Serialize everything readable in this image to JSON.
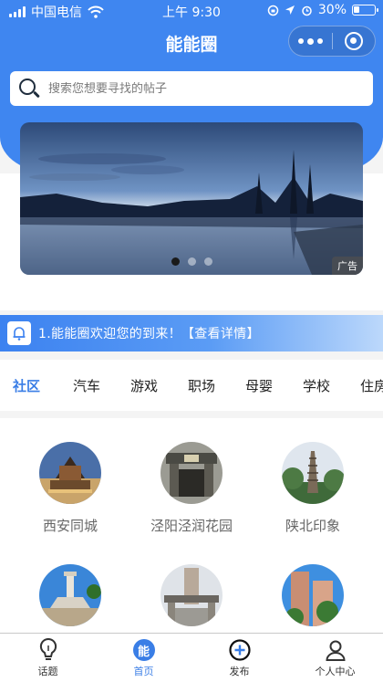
{
  "status_bar": {
    "carrier": "中国电信",
    "time": "上午 9:30",
    "battery": "30%"
  },
  "nav": {
    "title": "能能圈"
  },
  "search": {
    "placeholder": "搜索您想要寻找的帖子"
  },
  "banner": {
    "ad_label": "广告",
    "slide_count": 3,
    "active_slide": 1
  },
  "notice": {
    "text": "1.能能圈欢迎您的到来！【查看详情】"
  },
  "category_tabs": [
    {
      "label": "社区",
      "active": true
    },
    {
      "label": "汽车",
      "active": false
    },
    {
      "label": "游戏",
      "active": false
    },
    {
      "label": "职场",
      "active": false
    },
    {
      "label": "母婴",
      "active": false
    },
    {
      "label": "学校",
      "active": false
    },
    {
      "label": "住房",
      "active": false
    }
  ],
  "communities": [
    {
      "label": "西安同城"
    },
    {
      "label": "泾阳泾润花园"
    },
    {
      "label": "陕北印象"
    },
    {
      "label": ""
    },
    {
      "label": ""
    },
    {
      "label": ""
    }
  ],
  "tabbar": [
    {
      "label": "话题",
      "icon": "lightbulb-icon",
      "active": false
    },
    {
      "label": "首页",
      "icon": "home-badge-icon",
      "badge_text": "能",
      "active": true
    },
    {
      "label": "发布",
      "icon": "plus-circle-icon",
      "active": false
    },
    {
      "label": "个人中心",
      "icon": "person-icon",
      "active": false
    }
  ],
  "colors": {
    "primary": "#3f86f0",
    "active_text": "#3a7ee6",
    "label_gray": "#666666"
  }
}
